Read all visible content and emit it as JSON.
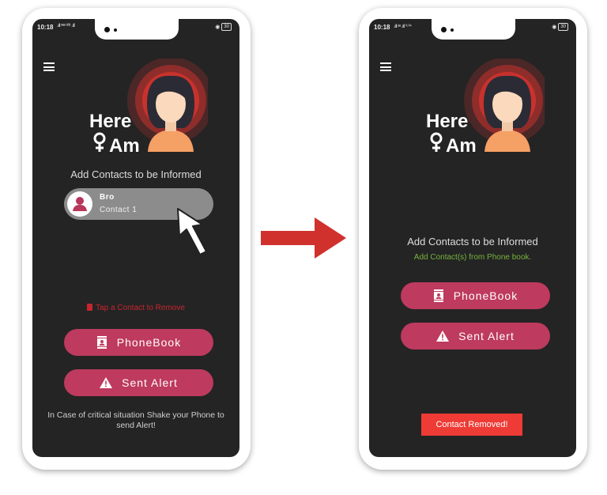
{
  "left_phone": {
    "status": {
      "time": "10:18",
      "signal": ".ıll ᵃᵃᵃ ⁸²⁸ .ıll",
      "battery": "30"
    },
    "logo": {
      "line1": "Here",
      "line2": "Am"
    },
    "subtitle": "Add Contacts to be Informed",
    "contact": {
      "name": "Bro",
      "label": "Contact 1"
    },
    "remove_hint": "Tap a Contact to Remove",
    "phonebook_label": "PhoneBook",
    "alert_label": "Sent Alert",
    "bottom_note": "In Case of critical situation Shake your Phone to send Alert!"
  },
  "right_phone": {
    "status": {
      "time": "10:18",
      "signal": ".ıll ᵃᵃ .ıll ⁰·⁰⁴",
      "battery": "30"
    },
    "logo": {
      "line1": "Here",
      "line2": "Am"
    },
    "subtitle": "Add Contacts to be Informed",
    "empty_hint": "Add Contact(s) from Phone book.",
    "phonebook_label": "PhoneBook",
    "alert_label": "Sent Alert",
    "toast": "Contact Removed!"
  },
  "colors": {
    "screen_bg": "#242424",
    "button": "#be3a5e",
    "toast": "#ee3b35",
    "hint_red": "#c8252e",
    "hint_green": "#76b43c",
    "arrow": "#d0312d"
  },
  "icons": [
    "menu-icon",
    "female-avatar-icon",
    "venus-icon",
    "person-icon",
    "cursor-arrow-icon",
    "trash-icon",
    "contact-book-icon",
    "warning-icon",
    "right-arrow-icon"
  ]
}
